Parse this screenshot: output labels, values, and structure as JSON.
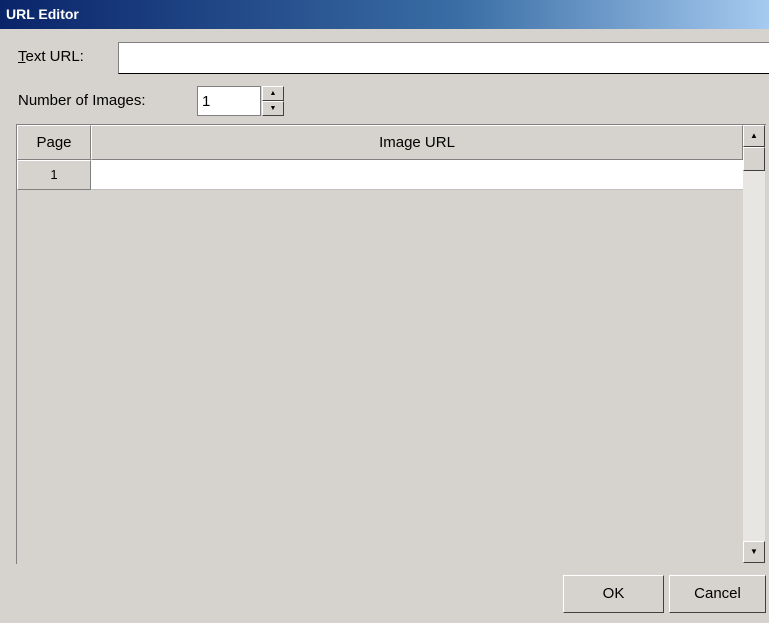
{
  "window": {
    "title": "URL Editor"
  },
  "text_url": {
    "label_prefix": "T",
    "label_rest": "ext URL:",
    "value": ""
  },
  "num_images": {
    "label": "Number of Images:",
    "value": "1"
  },
  "grid": {
    "columns": [
      "Page",
      "Image URL"
    ],
    "rows": [
      {
        "page": "1",
        "image_url": ""
      }
    ]
  },
  "buttons": {
    "ok": "OK",
    "cancel": "Cancel"
  },
  "colors": {
    "titlebar_start": "#0a246a",
    "titlebar_end": "#a6caf0",
    "face": "#d6d3ce"
  }
}
